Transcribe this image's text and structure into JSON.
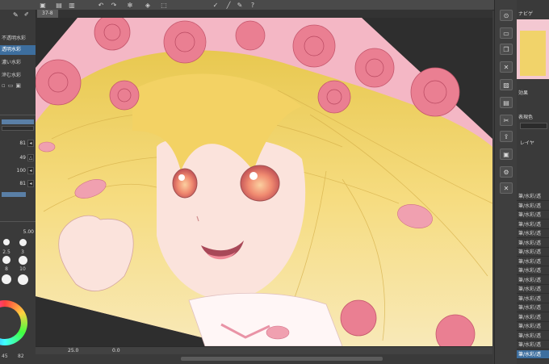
{
  "document_tab": "37-8",
  "toolbar_icons": [
    "app-icon",
    "open-icon",
    "save-icon",
    "undo-icon",
    "redo-icon",
    "settings-icon",
    "fill-icon",
    "select-icon",
    "pen-icon",
    "ruler-icon",
    "brush-icon",
    "help-icon"
  ],
  "subtools": [
    "不透明水彩",
    "透明水彩",
    "濃い水彩",
    "滲む水彩"
  ],
  "subtool_selected": 1,
  "properties": [
    {
      "value": "81"
    },
    {
      "value": "49"
    },
    {
      "value": "100"
    },
    {
      "value": "81"
    }
  ],
  "brush_size_label": "5.00",
  "brush_sizes": [
    "2.5",
    "3",
    "5",
    "8",
    "10"
  ],
  "bottom_values": {
    "left": "45",
    "right": "82"
  },
  "status": {
    "zoom": "25.0",
    "angle": "0.0"
  },
  "right_panel": {
    "effect_label": "効果",
    "color_label": "表現色",
    "layer_header": "レイヤ",
    "nav_label": "ナビゲ"
  },
  "layers": [
    "筆/水彩/透",
    "筆/水彩/透",
    "筆/水彩/透",
    "筆/水彩/透",
    "筆/水彩/透",
    "筆/水彩/透",
    "筆/水彩/透",
    "筆/水彩/透",
    "筆/水彩/透",
    "筆/水彩/透",
    "筆/水彩/透",
    "筆/水彩/透",
    "筆/水彩/透",
    "筆/水彩/透",
    "筆/水彩/透",
    "筆/水彩/透",
    "筆/水彩/透",
    "筆/水彩/透"
  ],
  "layer_selected": 17,
  "colors": {
    "selection": "#3d6e9e",
    "hair": "#f1d36a",
    "rose": "#ea7f92",
    "bg_pink": "#f4b7c5",
    "skin": "#fbe3dc"
  }
}
